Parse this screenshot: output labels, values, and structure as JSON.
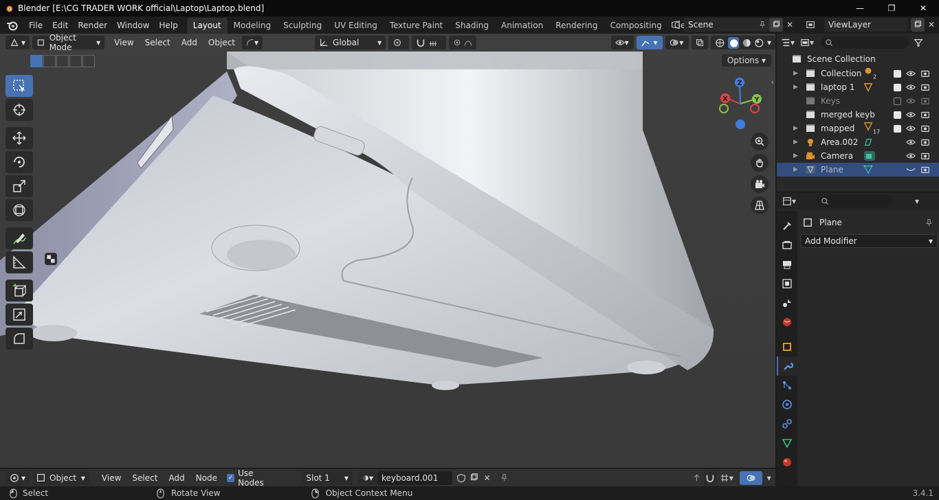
{
  "window": {
    "title": "Blender [E:\\CG TRADER WORK official\\Laptop\\Laptop.blend]",
    "controls": [
      "—",
      "❐",
      "✕"
    ]
  },
  "menu": [
    "File",
    "Edit",
    "Render",
    "Window",
    "Help"
  ],
  "workspaces": [
    "Layout",
    "Modeling",
    "Sculpting",
    "UV Editing",
    "Texture Paint",
    "Shading",
    "Animation",
    "Rendering",
    "Compositing",
    "Geometry Node"
  ],
  "active_workspace": "Layout",
  "scene": {
    "name": "Scene"
  },
  "view_layer": {
    "name": "ViewLayer"
  },
  "viewport": {
    "mode": "Object Mode",
    "menus": [
      "View",
      "Select",
      "Add",
      "Object"
    ],
    "orientation": "Global",
    "options_label": "Options",
    "gizmo_axes": {
      "x": "X",
      "y": "Y",
      "z": "Z"
    }
  },
  "outliner": {
    "root": "Scene Collection",
    "rows": [
      {
        "name": "Collection",
        "badge": "2"
      },
      {
        "name": "laptop 1",
        "badge": ""
      },
      {
        "name": "Keys",
        "badge": ""
      },
      {
        "name": "merged keyb",
        "badge": ""
      },
      {
        "name": "mapped",
        "badge": "17"
      },
      {
        "name": "Area.002",
        "badge": ""
      },
      {
        "name": "Camera",
        "badge": ""
      },
      {
        "name": "Plane",
        "badge": ""
      }
    ]
  },
  "properties": {
    "object_name": "Plane",
    "add_modifier": "Add Modifier"
  },
  "shader_header": {
    "editor": "Object",
    "menus": [
      "View",
      "Select",
      "Add",
      "Node"
    ],
    "use_nodes_label": "Use Nodes",
    "slot": "Slot 1",
    "material": "keyboard.001"
  },
  "status": {
    "left_action": "Select",
    "middle_action": "Rotate View",
    "right_action": "Object Context Menu",
    "version": "3.4.1"
  },
  "colors": {
    "accent": "#4772b3",
    "x_axis": "#e0404a",
    "y_axis": "#8bc34a",
    "z_axis": "#3f7ee0"
  }
}
